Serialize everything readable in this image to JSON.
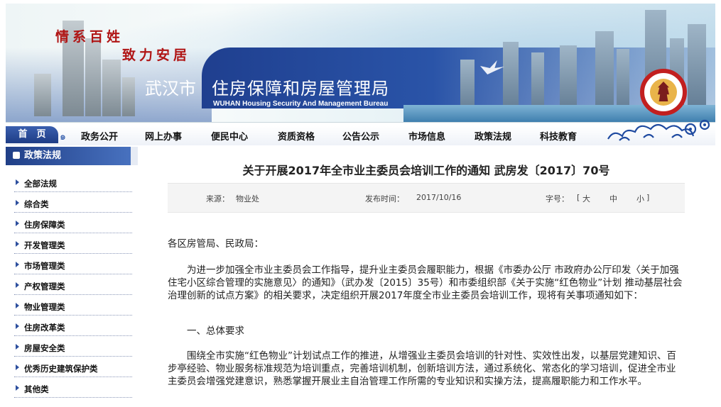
{
  "banner": {
    "slogan_1": "情系百姓",
    "slogan_2": "致力安居",
    "city": "武汉市",
    "bureau": "住房保障和房屋管理局",
    "bureau_en": "WUHAN Housing Security And Management Bureau"
  },
  "nav": {
    "home": "首　页",
    "items": [
      "政务公开",
      "网上办事",
      "便民中心",
      "资质资格",
      "公告公示",
      "市场信息",
      "政策法规",
      "科技教育"
    ]
  },
  "sidebar": {
    "title": "政策法规",
    "items": [
      "全部法规",
      "综合类",
      "住房保障类",
      "开发管理类",
      "市场管理类",
      "产权管理类",
      "物业管理类",
      "住房改革类",
      "房屋安全类",
      "优秀历史建筑保护类",
      "其他类"
    ]
  },
  "article": {
    "title": "关于开展2017年全市业主委员会培训工作的通知 武房发〔2017〕70号",
    "source_label": "来源：",
    "source_value": "物业处",
    "date_label": "发布时间：",
    "date_value": "2017/10/16",
    "fontsize_label": "字号：",
    "fontsize_open": "[",
    "fontsize_large": "大",
    "fontsize_medium": "中",
    "fontsize_small": "小",
    "fontsize_close": "]",
    "salutation": "各区房管局、民政局：",
    "para1": "为进一步加强全市业主委员会工作指导，提升业主委员会履职能力，根据《市委办公厅 市政府办公厅印发〈关于加强住宅小区综合管理的实施意见〉的通知》（武办发〔2015〕35号）和市委组织部《关于实施“红色物业”计划 推动基层社会治理创新的试点方案》的相关要求，决定组织开展2017年度全市业主委员会培训工作，现将有关事项通知如下：",
    "section1": "一、总体要求",
    "para2": "围绕全市实施“红色物业”计划试点工作的推进，从增强业主委员会培训的针对性、实效性出发，以基层党建知识、百步亭经验、物业服务标准规范为培训重点，完善培训机制，创新培训方法，通过系统化、常态化的学习培训，促进全市业主委员会增强党建意识，熟悉掌握开展业主自治管理工作所需的专业知识和实操方法，提高履职能力和工作水平。"
  },
  "colors": {
    "nav_blue": "#1e3d86",
    "slogan_red": "#b01515",
    "emblem_red": "#c21f1f"
  }
}
